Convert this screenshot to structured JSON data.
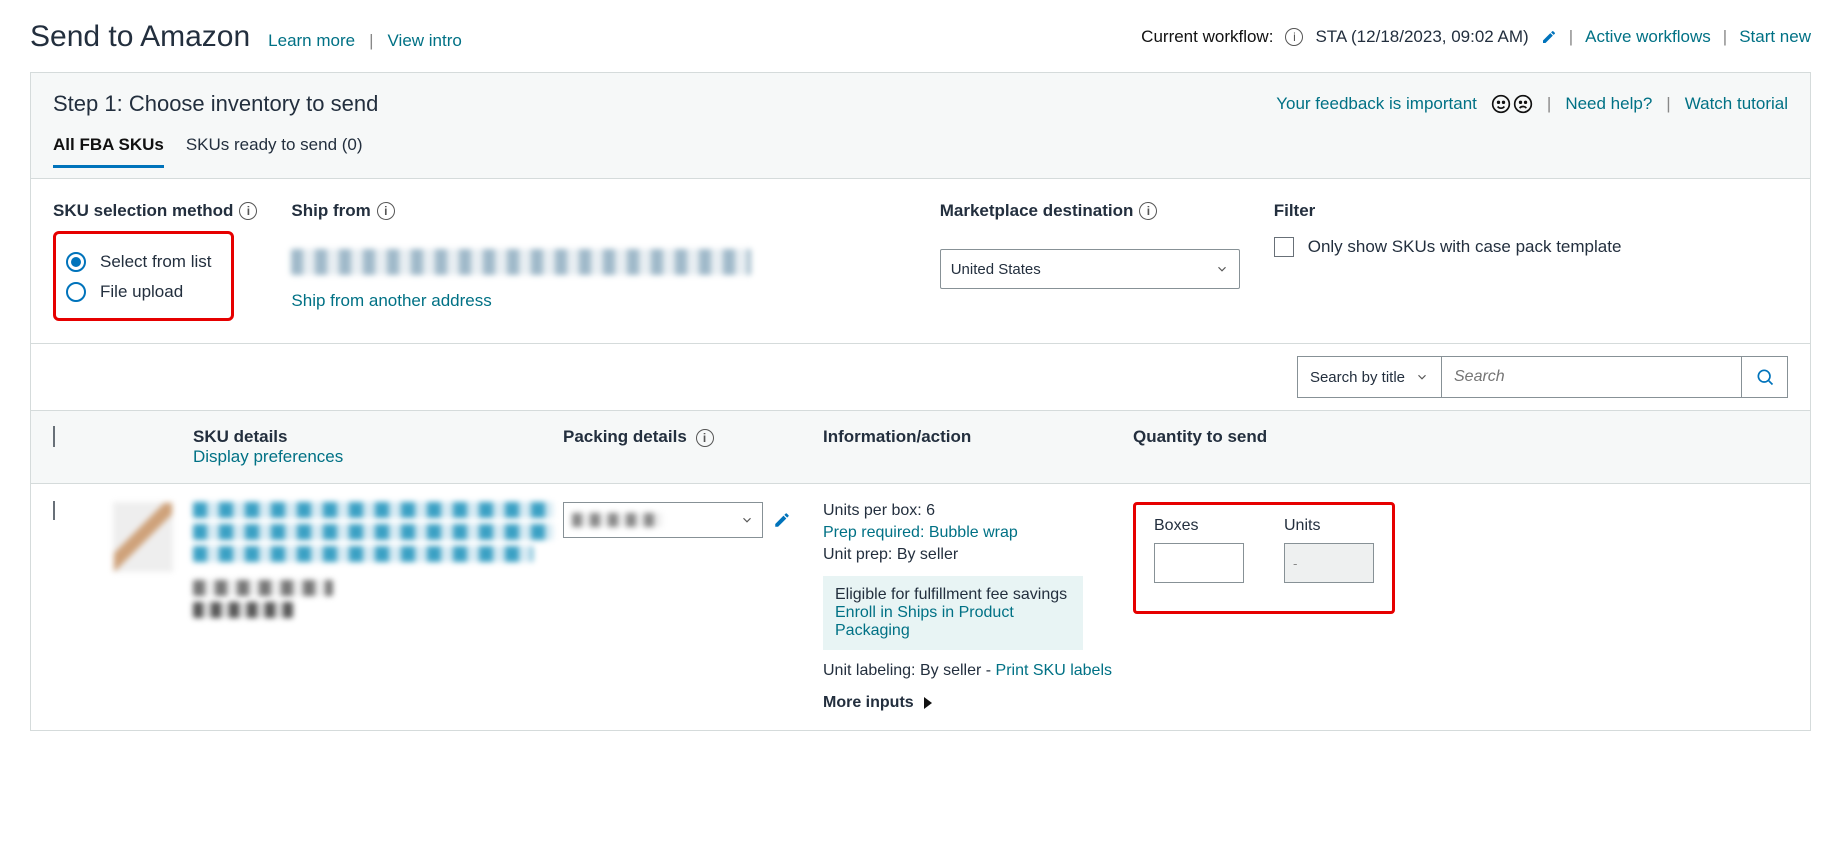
{
  "header": {
    "title": "Send to Amazon",
    "learn_more": "Learn more",
    "view_intro": "View intro",
    "workflow_label": "Current workflow:",
    "workflow_value": "STA (12/18/2023, 09:02 AM)",
    "active_workflows": "Active workflows",
    "start_new": "Start new"
  },
  "panel": {
    "step_title": "Step 1: Choose inventory to send",
    "feedback": "Your feedback is important",
    "need_help": "Need help?",
    "watch_tutorial": "Watch tutorial",
    "tabs": {
      "all": "All FBA SKUs",
      "ready": "SKUs ready to send (0)"
    }
  },
  "options": {
    "sku_method_label": "SKU selection method",
    "radio_select_list": "Select from list",
    "radio_file_upload": "File upload",
    "ship_from_label": "Ship from",
    "ship_another": "Ship from another address",
    "marketplace_label": "Marketplace destination",
    "marketplace_value": "United States",
    "filter_label": "Filter",
    "filter_checkbox": "Only show SKUs with case pack template"
  },
  "search": {
    "type": "Search by title",
    "placeholder": "Search"
  },
  "table": {
    "headers": {
      "sku": "SKU details",
      "display_prefs": "Display preferences",
      "packing": "Packing details",
      "info": "Information/action",
      "qty": "Quantity to send"
    },
    "row": {
      "units_per_box": "Units per box: 6",
      "prep_required": "Prep required: Bubble wrap",
      "unit_prep": "Unit prep: By seller",
      "callout_text": "Eligible for fulfillment fee savings",
      "callout_link": "Enroll in Ships in Product Packaging",
      "unit_labeling": "Unit labeling: By seller - ",
      "print_sku": "Print SKU labels",
      "more_inputs": "More inputs",
      "boxes_label": "Boxes",
      "units_label": "Units",
      "units_value": "-"
    }
  }
}
